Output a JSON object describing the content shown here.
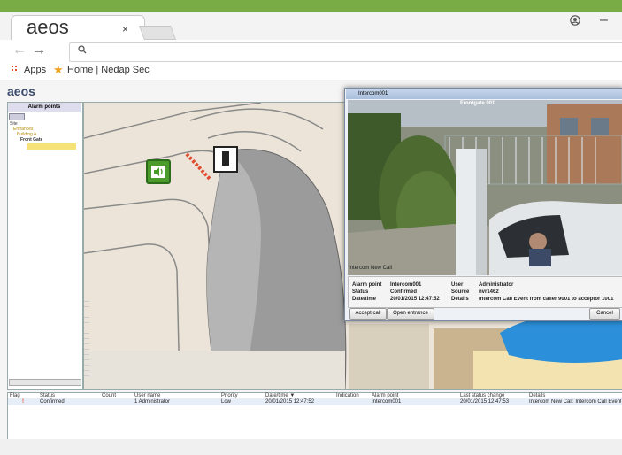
{
  "browser": {
    "tab_title": "aeos",
    "tab_close": "×",
    "account_icon": "account-icon",
    "minimize": "–",
    "back": "←",
    "forward": "→",
    "search_glyph": "⚲",
    "bookmarks": [
      {
        "label": "Apps"
      },
      {
        "label": "Home | Nedap Securi"
      }
    ]
  },
  "app": {
    "logo": "aeos",
    "panel_title": "Alarm points",
    "tree": [
      "Site",
      "Entrances",
      "Building A",
      "Front Gate"
    ],
    "dialog": {
      "title": "Intercom001",
      "camera_label": "Frontgate 001",
      "section": "Intercom New Call",
      "fields": [
        {
          "k": "Alarm point",
          "v": "Intercom001",
          "k2": "User",
          "v2": "Administrator"
        },
        {
          "k": "Status",
          "v": "Confirmed",
          "k2": "Source",
          "v2": "nvr1462"
        },
        {
          "k": "Date/time",
          "v": "20/01/2015 12:47:52",
          "k2": "Details",
          "v2": "Intercom Call Event from caller 9001 to acceptor 1001"
        }
      ],
      "buttons": {
        "accept": "Accept call",
        "open": "Open entrance",
        "cancel": "Cancel"
      }
    },
    "table": {
      "headers": [
        "Flag",
        "Status",
        "Count",
        "User name",
        "Priority",
        "Date/time ▼",
        "Indication",
        "Alarm point",
        "Last status change",
        "Details"
      ],
      "row": [
        "!",
        "Confirmed",
        "",
        "1 Administrator",
        "Low",
        "20/01/2015 12:47:52",
        "",
        "Intercom001",
        "20/01/2015 12:47:53",
        "Intercom New Call: Intercom Call Event fro"
      ]
    },
    "colors": {
      "accent": "#7aac45",
      "alert": "#e04a2f",
      "water": "#2b8fd9",
      "sand": "#f3e3b0"
    }
  }
}
